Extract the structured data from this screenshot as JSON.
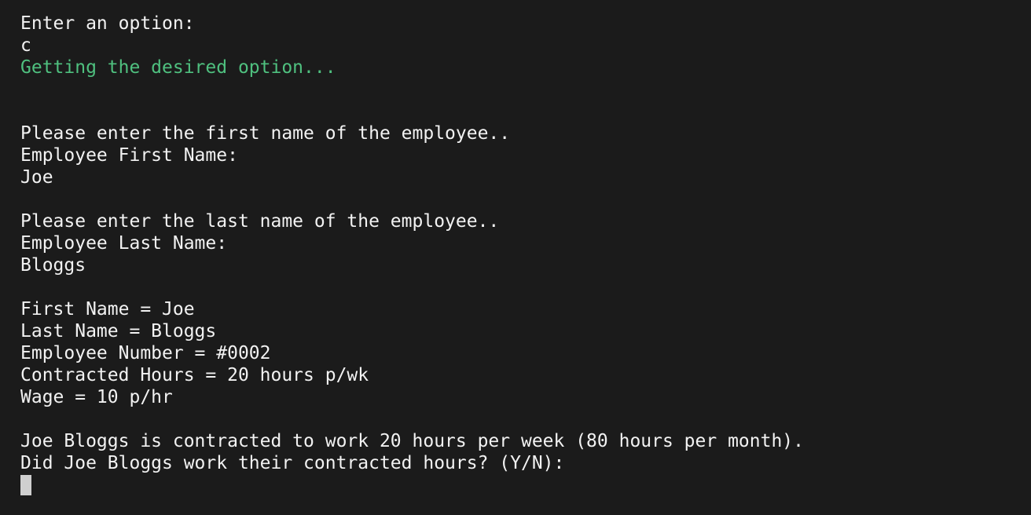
{
  "colors": {
    "background": "#1b1b1b",
    "text": "#f2f2f2",
    "status_text": "#4fc07f",
    "cursor": "#cfcfcf"
  },
  "terminal": {
    "menu_prompt": "Enter an option:",
    "option_input": "c",
    "status_message": "Getting the desired option...",
    "first_name_instruction": "Please enter the first name of the employee..",
    "first_name_prompt": "Employee First Name:",
    "first_name_input": "Joe",
    "last_name_instruction": "Please enter the last name of the employee..",
    "last_name_prompt": "Employee Last Name:",
    "last_name_input": "Bloggs",
    "summary": {
      "first_name": "First Name = Joe",
      "last_name": "Last Name = Bloggs",
      "employee_number": "Employee Number = #0002",
      "contracted_hours": "Contracted Hours = 20 hours p/wk",
      "wage": "Wage = 10 p/hr"
    },
    "contract_info": "Joe Bloggs is contracted to work 20 hours per week (80 hours per month).",
    "hours_question": "Did Joe Bloggs work their contracted hours? (Y/N):"
  }
}
